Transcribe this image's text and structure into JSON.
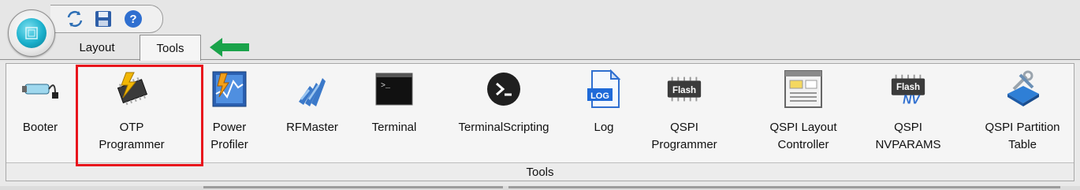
{
  "tabs": [
    {
      "label": "Layout",
      "active": false
    },
    {
      "label": "Tools",
      "active": true
    }
  ],
  "quick_access": [
    "refresh-icon",
    "save-icon",
    "help-icon"
  ],
  "group_label": "Tools",
  "tools": [
    {
      "name": "booter",
      "label": "Booter",
      "icon": "booter-cable-icon"
    },
    {
      "name": "otp-programmer",
      "label": "OTP\nProgrammer",
      "icon": "chip-lightning-icon",
      "highlighted": true
    },
    {
      "name": "power-profiler",
      "label": "Power\nProfiler",
      "icon": "power-profiler-icon"
    },
    {
      "name": "rfmaster",
      "label": "RFMaster",
      "icon": "rf-waves-icon"
    },
    {
      "name": "terminal",
      "label": "Terminal",
      "icon": "terminal-window-icon"
    },
    {
      "name": "terminal-scripting",
      "label": "TerminalScripting",
      "icon": "terminal-circle-icon"
    },
    {
      "name": "log",
      "label": "Log",
      "icon": "log-file-icon",
      "icon_text": "LOG"
    },
    {
      "name": "qspi-programmer",
      "label": "QSPI\nProgrammer",
      "icon": "flash-chip-icon",
      "icon_text": "Flash"
    },
    {
      "name": "qspi-layout-controller",
      "label": "QSPI Layout\nController",
      "icon": "layout-window-icon"
    },
    {
      "name": "qspi-nvparams",
      "label": "QSPI\nNVPARAMS",
      "icon": "flash-nv-icon",
      "icon_text": "Flash",
      "icon_sub": "NV"
    },
    {
      "name": "qspi-partition-table",
      "label": "QSPI Partition\nTable",
      "icon": "partition-tools-icon"
    }
  ],
  "colors": {
    "highlight": "#e8141c",
    "arrow": "#1aa34a",
    "app_button": "#1ab0cc"
  }
}
